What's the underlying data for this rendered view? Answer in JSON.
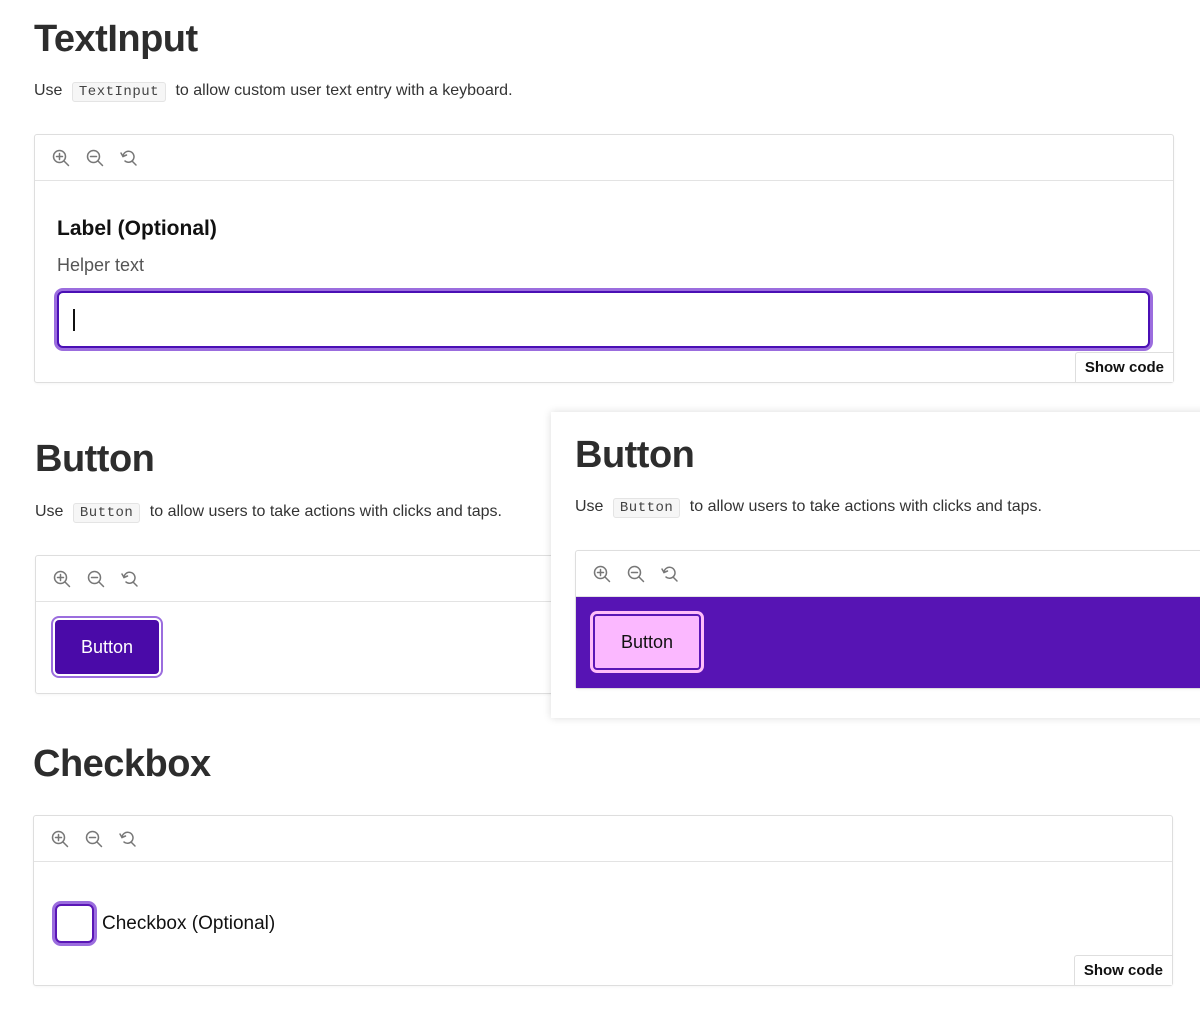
{
  "colors": {
    "accent": "#4a0aa8",
    "focus_ring": "#9b6dde",
    "button_canvas": "#5714b4",
    "pink_button": "#fbb8ff"
  },
  "icons": [
    "zoom-in-icon",
    "zoom-out-icon",
    "reset-zoom-icon"
  ],
  "textinput": {
    "title": "TextInput",
    "desc_prefix": "Use",
    "code": "TextInput",
    "desc_suffix": "to allow custom user text entry with a keyboard.",
    "label": "Label (Optional)",
    "helper": "Helper text",
    "value": "",
    "show_code": "Show code"
  },
  "button": {
    "title": "Button",
    "desc_prefix": "Use",
    "code": "Button",
    "desc_suffix": "to allow users to take actions with clicks and taps.",
    "button_label": "Button"
  },
  "button_overlay": {
    "title": "Button",
    "desc_prefix": "Use",
    "code": "Button",
    "desc_suffix": "to allow users to take actions with clicks and taps.",
    "button_label": "Button"
  },
  "checkbox": {
    "title": "Checkbox",
    "label": "Checkbox (Optional)",
    "checked": false,
    "show_code": "Show code"
  }
}
